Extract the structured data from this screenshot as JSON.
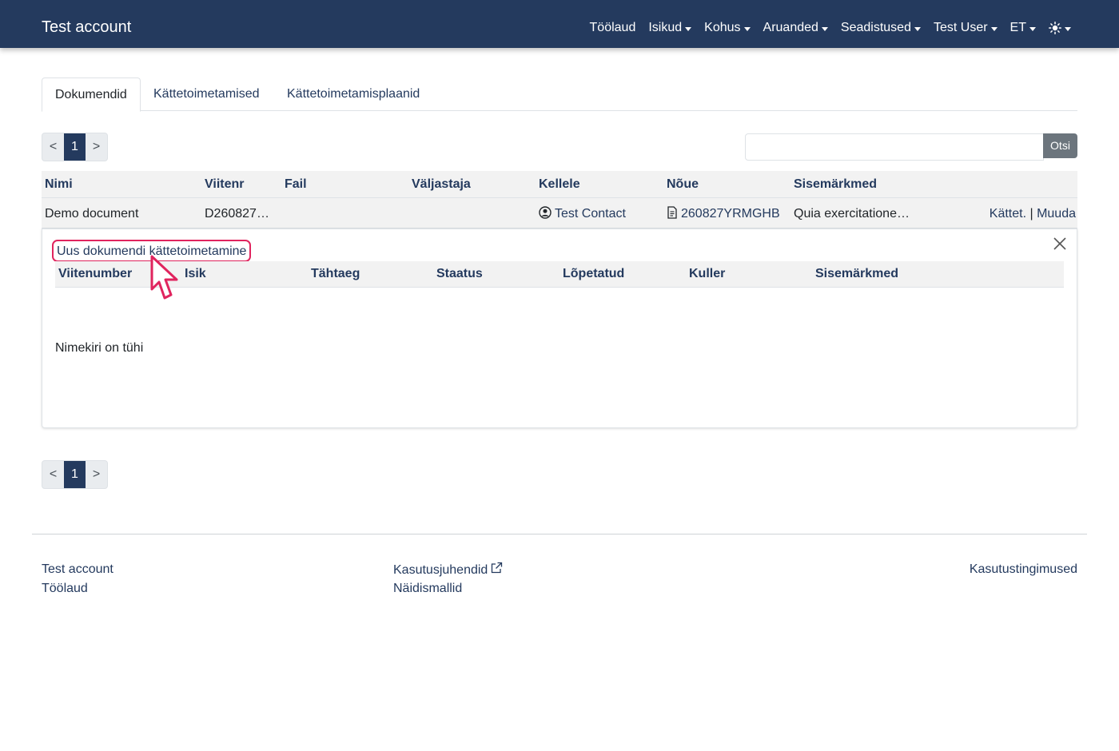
{
  "navbar": {
    "brand": "Test account",
    "items": [
      {
        "label": "Töölaud",
        "dropdown": false
      },
      {
        "label": "Isikud",
        "dropdown": true
      },
      {
        "label": "Kohus",
        "dropdown": true
      },
      {
        "label": "Aruanded",
        "dropdown": true
      },
      {
        "label": "Seadistused",
        "dropdown": true
      },
      {
        "label": "Test User",
        "dropdown": true
      },
      {
        "label": "ET",
        "dropdown": true
      }
    ],
    "theme_icon": "sun-icon"
  },
  "tabs": [
    {
      "label": "Dokumendid",
      "active": true
    },
    {
      "label": "Kättetoimetamised",
      "active": false
    },
    {
      "label": "Kättetoimetamisplaanid",
      "active": false
    }
  ],
  "pagination": {
    "prev": "<",
    "current": "1",
    "next": ">"
  },
  "search": {
    "placeholder": "",
    "button": "Otsi"
  },
  "table": {
    "headers": [
      "Nimi",
      "Viitenr",
      "Fail",
      "Väljastaja",
      "Kellele",
      "Nõue",
      "Sisemärkmed"
    ],
    "rows": [
      {
        "nimi": "Demo document",
        "viitenr": "D260827…",
        "fail": "",
        "valjastaja": "",
        "kellele": "Test Contact",
        "noue": "260827YRMGHB",
        "sisemarkmed": "Quia exercitatione…",
        "action_delivery": "Kättet.",
        "action_separator": "|",
        "action_edit": "Muuda"
      }
    ]
  },
  "subpanel": {
    "new_link": "Uus dokumendi kättetoimetamine",
    "headers": [
      "Viitenumber",
      "Isik",
      "Tähtaeg",
      "Staatus",
      "Lõpetatud",
      "Kuller",
      "Sisemärkmed"
    ],
    "empty_text": "Nimekiri on tühi"
  },
  "footer": {
    "col1": [
      "Test account",
      "Töölaud"
    ],
    "col2": [
      "Kasutusjuhendid",
      "Näidismallid"
    ],
    "col3": [
      "Kasutustingimused"
    ]
  },
  "colors": {
    "navbar": "#243a5e",
    "link": "#243a5e",
    "highlight": "#e0245e"
  }
}
